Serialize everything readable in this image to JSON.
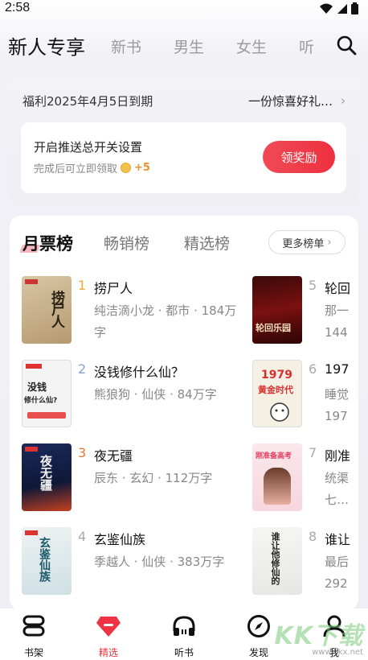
{
  "status_bar": {
    "time": "2:58"
  },
  "top_nav": {
    "tabs": [
      "新人专享",
      "新书",
      "男生",
      "女生",
      "听"
    ],
    "active_index": 0
  },
  "promo": {
    "deadline": "福利2025年4月5日到期",
    "gift": "一份惊喜好礼…",
    "card_title": "开启推送总开关设置",
    "card_sub": "完成后可立即领取",
    "card_reward": "+5",
    "button": "领奖励"
  },
  "ranking": {
    "tabs": [
      "月票榜",
      "畅销榜",
      "精选榜"
    ],
    "more": "更多榜单",
    "books_left": [
      {
        "rank": "1",
        "title": "捞尸人",
        "meta": "纯洁滴小龙 · 都市 · 184万字",
        "rank_color": "#f0a830"
      },
      {
        "rank": "2",
        "title": "没钱修什么仙？",
        "meta": "熊狼狗 · 仙侠 · 84万字",
        "rank_color": "#8aa0c8"
      },
      {
        "rank": "3",
        "title": "夜无疆",
        "meta": "辰东 · 玄幻 · 112万字",
        "rank_color": "#e07a30"
      },
      {
        "rank": "4",
        "title": "玄鉴仙族",
        "meta": "季越人 · 仙侠 · 383万字",
        "rank_color": "#aaaaaa"
      }
    ],
    "books_right": [
      {
        "rank": "5",
        "title": "轮回",
        "meta": "那一",
        "meta2": "144"
      },
      {
        "rank": "6",
        "title": "197",
        "meta": "睡觉",
        "meta2": "197"
      },
      {
        "rank": "7",
        "title": "刚准",
        "meta": "统渠",
        "meta2": "七…"
      },
      {
        "rank": "8",
        "title": "谁让",
        "meta": "最后",
        "meta2": "292"
      }
    ],
    "covers": {
      "c1": "捞尸人",
      "c2a": "没钱",
      "c2b": "修什么仙?",
      "c3": "夜无疆",
      "c4": "玄鉴仙族",
      "c5": "轮回乐园",
      "c6a": "1979",
      "c6b": "黄金时代",
      "c7": "刚准备高考",
      "c8": "谁让他修仙的"
    }
  },
  "bottom_nav": {
    "items": [
      "书架",
      "精选",
      "听书",
      "发现",
      "我"
    ],
    "active_index": 1
  },
  "watermark": {
    "text": "KK下载",
    "url": "www.kkx.net"
  }
}
